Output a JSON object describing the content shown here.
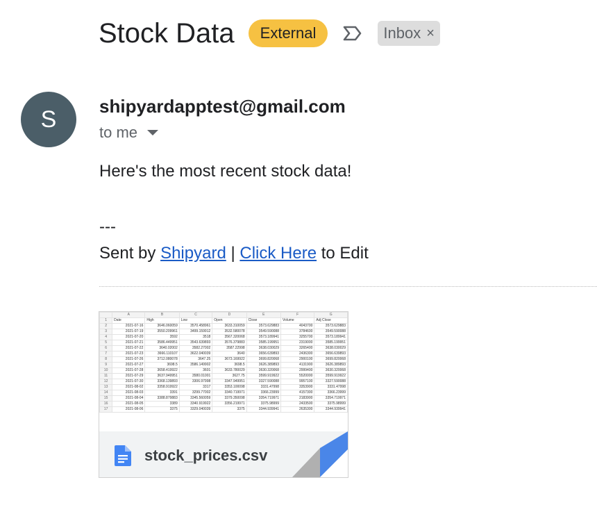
{
  "subject": "Stock Data",
  "labels": {
    "external": "External",
    "inbox": "Inbox",
    "inbox_close": "×"
  },
  "sender": {
    "avatar_letter": "S",
    "email": "shipyardapptest@gmail.com",
    "to": "to me"
  },
  "body": {
    "line1": "Here's the most recent stock data!",
    "sep": "---",
    "sent_by": "Sent by ",
    "link1": "Shipyard",
    "pipe": " | ",
    "link2": "Click Here",
    "to_edit": " to Edit"
  },
  "attachment": {
    "filename": "stock_prices.csv",
    "icon": "google-docs-icon",
    "col_letters": [
      "A",
      "B",
      "C",
      "D",
      "E",
      "F",
      "G"
    ],
    "rows": [
      [
        "Date",
        "High",
        "Low",
        "Open",
        "Close",
        "Volume",
        "Adj Close"
      ],
      [
        "2021-07-16",
        "3646.060059",
        "3570.458961",
        "3633.310059",
        "3573.629883",
        "4043700",
        "3573.629883"
      ],
      [
        "2021-07-19",
        "3550.209961",
        "3499.159912",
        "3532.580078",
        "3549.590088",
        "3784600",
        "3549.590088"
      ],
      [
        "2021-07-20",
        "3592",
        "3518",
        "3567.320068",
        "3573.189941",
        "3255700",
        "3573.189941"
      ],
      [
        "2021-07-21",
        "3586.449951",
        "3543.639893",
        "3576.379883",
        "3585.199951",
        "2319000",
        "3585.199951"
      ],
      [
        "2021-07-22",
        "3640.02002",
        "3582.27002",
        "3587.22998",
        "3638.030029",
        "3265400",
        "3638.030029"
      ],
      [
        "2021-07-23",
        "3666.110107",
        "3622.040039",
        "3640",
        "3656.639893",
        "2436300",
        "3656.639893"
      ],
      [
        "2021-07-26",
        "3712.080078",
        "3647.25",
        "3673.169922",
        "3699.820068",
        "2900100",
        "3699.820068"
      ],
      [
        "2021-07-27",
        "3698.5",
        "3586.149902",
        "3698.5",
        "3626.389893",
        "4131900",
        "3626.389893"
      ],
      [
        "2021-07-28",
        "3658.419922",
        "3601",
        "3633.780029",
        "3630.320068",
        "2999400",
        "3630.320068"
      ],
      [
        "2021-07-29",
        "3637.949951",
        "3580.01001",
        "3627.75",
        "3599.919922",
        "5520000",
        "3599.919922"
      ],
      [
        "2021-07-30",
        "3368.139893",
        "3306.97998",
        "3347.949951",
        "3327.590088",
        "9957100",
        "3327.590088"
      ],
      [
        "2021-08-02",
        "3358.919922",
        "3317",
        "3353.100098",
        "3331.47998",
        "3353900",
        "3331.47998"
      ],
      [
        "2021-08-03",
        "3391",
        "3299.77002",
        "3340.719971",
        "3366.23999",
        "4157300",
        "3366.23999"
      ],
      [
        "2021-08-04",
        "3388.879883",
        "3345.560059",
        "3379.350098",
        "3354.719971",
        "2183900",
        "3354.719971"
      ],
      [
        "2021-08-05",
        "3389",
        "3340.919922",
        "3356.219971",
        "3375.98999",
        "2433500",
        "3375.98999"
      ],
      [
        "2021-08-06",
        "3375",
        "3329.040039",
        "3375",
        "3344.939941",
        "2635300",
        "3344.939941"
      ]
    ]
  },
  "colors": {
    "external_label": "#f6c142",
    "avatar": "#4b5e68",
    "link": "#1a5bc6",
    "doc_icon": "#4285f4"
  }
}
